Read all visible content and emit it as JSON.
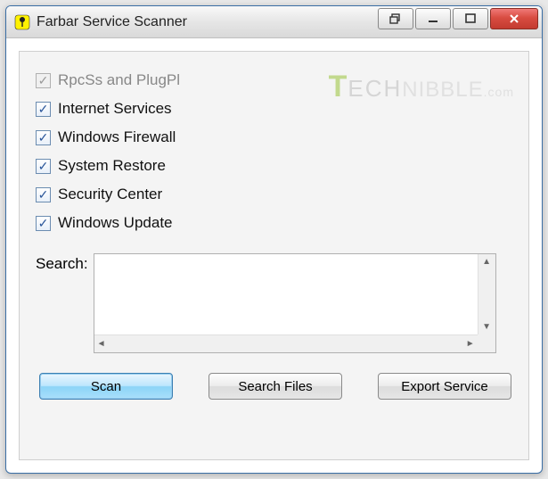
{
  "window": {
    "title": "Farbar Service Scanner"
  },
  "checks": [
    {
      "label": "RpcSs and PlugPl",
      "checked": true,
      "disabled": true
    },
    {
      "label": "Internet Services",
      "checked": true,
      "disabled": false
    },
    {
      "label": "Windows Firewall",
      "checked": true,
      "disabled": false
    },
    {
      "label": "System Restore",
      "checked": true,
      "disabled": false
    },
    {
      "label": "Security Center",
      "checked": true,
      "disabled": false
    },
    {
      "label": "Windows Update",
      "checked": true,
      "disabled": false
    }
  ],
  "search": {
    "label": "Search:",
    "value": ""
  },
  "buttons": {
    "scan": "Scan",
    "search_files": "Search Files",
    "export_service": "Export Service"
  },
  "watermark": {
    "brand_first": "T",
    "brand_mid": "ECH",
    "brand_rest": "NIBBLE",
    "brand_com": ".com"
  }
}
